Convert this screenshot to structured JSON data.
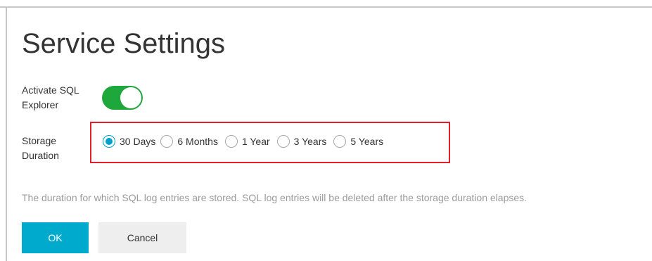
{
  "page": {
    "title": "Service Settings"
  },
  "activate": {
    "label_line1": "Activate SQL",
    "label_line2": "Explorer",
    "enabled": true,
    "toggle_color": "#1ea83c"
  },
  "storage": {
    "label_line1": "Storage",
    "label_line2": "Duration",
    "options": [
      "30 Days",
      "6 Months",
      "1 Year",
      "3 Years",
      "5 Years"
    ],
    "selected": "30 Days",
    "accent_color": "#00a2ca",
    "highlight_color": "#e0202a"
  },
  "help": {
    "text": "The duration for which SQL log entries are stored. SQL log entries will be deleted after the storage duration elapses."
  },
  "actions": {
    "ok_label": "OK",
    "cancel_label": "Cancel",
    "ok_color": "#00aacc"
  }
}
